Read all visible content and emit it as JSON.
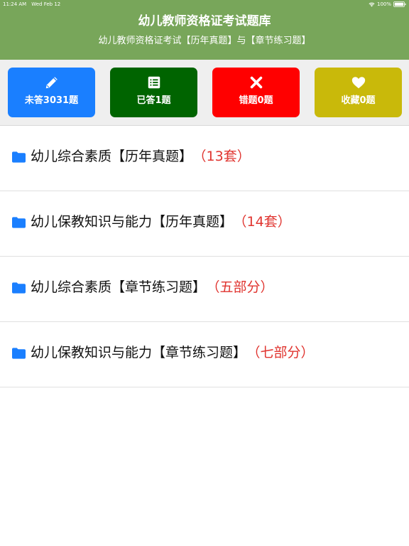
{
  "status_bar": {
    "time": "11:24 AM",
    "date": "Wed Feb 12",
    "battery": "100%",
    "wifi_icon": "wifi-icon",
    "battery_icon": "battery-icon"
  },
  "header": {
    "title": "幼儿教师资格证考试题库",
    "subtitle": "幼儿教师资格证考试【历年真题】与【章节练习题】",
    "background": "#78a65a"
  },
  "stats": [
    {
      "label": "未答3031题",
      "icon": "pencil-icon",
      "color": "#1a7fff"
    },
    {
      "label": "已答1题",
      "icon": "list-icon",
      "color": "#006400"
    },
    {
      "label": "错题0题",
      "icon": "close-icon",
      "color": "#ff0000"
    },
    {
      "label": "收藏0题",
      "icon": "heart-icon",
      "color": "#c9b90a"
    }
  ],
  "categories": [
    {
      "title": "幼儿综合素质【历年真题】",
      "count": "（13套）",
      "icon": "folder-icon"
    },
    {
      "title": "幼儿保教知识与能力【历年真题】",
      "count": "（14套）",
      "icon": "folder-icon"
    },
    {
      "title": "幼儿综合素质【章节练习题】",
      "count": "（五部分）",
      "icon": "folder-icon"
    },
    {
      "title": "幼儿保教知识与能力【章节练习题】",
      "count": "（七部分）",
      "icon": "folder-icon"
    }
  ],
  "colors": {
    "count_text": "#e0342f",
    "folder_icon": "#1a7fff"
  }
}
